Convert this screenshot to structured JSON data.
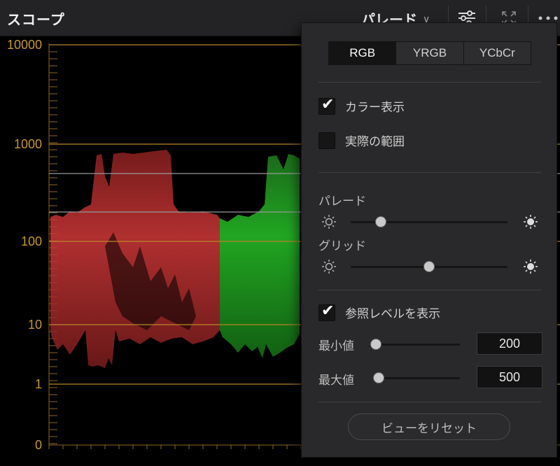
{
  "header": {
    "title": "スコープ",
    "mode_label": "パレード",
    "icons": [
      "settings-sliders-icon",
      "expand-icon",
      "more-icon"
    ]
  },
  "scope": {
    "y_labels": [
      "10000",
      "1000",
      "100",
      "10",
      "1",
      "0"
    ],
    "colors": {
      "grid": "#b8862a",
      "red": "#d83a3a",
      "green": "#2cd22c"
    }
  },
  "popup": {
    "modes": [
      "RGB",
      "YRGB",
      "YCbCr"
    ],
    "active_mode": "RGB",
    "show_color": {
      "label": "カラー表示",
      "checked": true
    },
    "actual_range": {
      "label": "実際の範囲",
      "checked": false
    },
    "parade_label": "パレード",
    "parade_level": 0.19,
    "grid_label": "グリッド",
    "grid_level": 0.5,
    "ref_level": {
      "label": "参照レベルを表示",
      "checked": true
    },
    "min_label": "最小値",
    "min_value": "200",
    "max_label": "最大値",
    "max_value": "500",
    "reset_label": "ビューをリセット"
  }
}
